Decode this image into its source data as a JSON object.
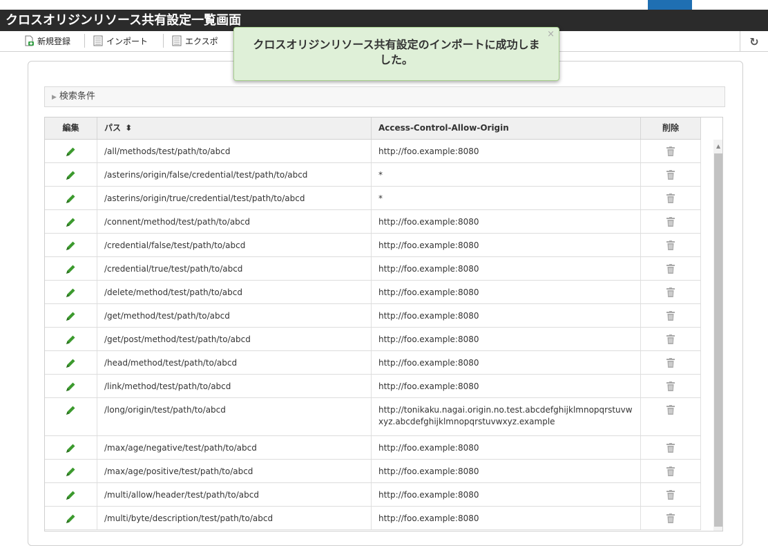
{
  "window": {
    "title": "クロスオリジンリソース共有設定一覧画面"
  },
  "toolbar": {
    "new_label": "新規登録",
    "import_label": "インポート",
    "export_label": "エクスポ",
    "refresh_icon": "refresh-icon"
  },
  "toast": {
    "message": "クロスオリジンリソース共有設定のインポートに成功しました。",
    "close": "×"
  },
  "search": {
    "label": "検索条件"
  },
  "table": {
    "headers": {
      "edit": "編集",
      "path": "パス",
      "sort_icon": "⬍",
      "origin": "Access-Control-Allow-Origin",
      "delete": "削除"
    },
    "rows": [
      {
        "path": "/all/methods/test/path/to/abcd",
        "origin": "http://foo.example:8080"
      },
      {
        "path": "/asterins/origin/false/credential/test/path/to/abcd",
        "origin": "*"
      },
      {
        "path": "/asterins/origin/true/credential/test/path/to/abcd",
        "origin": "*"
      },
      {
        "path": "/connent/method/test/path/to/abcd",
        "origin": "http://foo.example:8080"
      },
      {
        "path": "/credential/false/test/path/to/abcd",
        "origin": "http://foo.example:8080"
      },
      {
        "path": "/credential/true/test/path/to/abcd",
        "origin": "http://foo.example:8080"
      },
      {
        "path": "/delete/method/test/path/to/abcd",
        "origin": "http://foo.example:8080"
      },
      {
        "path": "/get/method/test/path/to/abcd",
        "origin": "http://foo.example:8080"
      },
      {
        "path": "/get/post/method/test/path/to/abcd",
        "origin": "http://foo.example:8080"
      },
      {
        "path": "/head/method/test/path/to/abcd",
        "origin": "http://foo.example:8080"
      },
      {
        "path": "/link/method/test/path/to/abcd",
        "origin": "http://foo.example:8080"
      },
      {
        "path": "/long/origin/test/path/to/abcd",
        "origin": "http://tonikaku.nagai.origin.no.test.abcdefghijklmnopqrstuvwxyz.abcdefghijklmnopqrstuvwxyz.example"
      },
      {
        "path": "/max/age/negative/test/path/to/abcd",
        "origin": "http://foo.example:8080"
      },
      {
        "path": "/max/age/positive/test/path/to/abcd",
        "origin": "http://foo.example:8080"
      },
      {
        "path": "/multi/allow/header/test/path/to/abcd",
        "origin": "http://foo.example:8080"
      },
      {
        "path": "/multi/byte/description/test/path/to/abcd",
        "origin": "http://foo.example:8080"
      }
    ]
  },
  "colors": {
    "titlebar": "#2b2b2b",
    "toast_bg": "#dff0d8",
    "edit_icon": "#3c9a2e",
    "delete_icon": "#a9a9a9"
  }
}
